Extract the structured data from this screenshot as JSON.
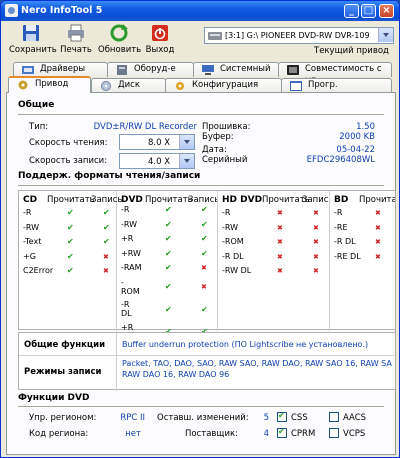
{
  "window": {
    "title": "Nero InfoTool 5",
    "minimize_glyph": "_",
    "maximize_glyph": "□",
    "close_glyph": "×"
  },
  "toolbar": {
    "save_label": "Сохранить",
    "print_label": "Печать",
    "refresh_label": "Обновить",
    "exit_label": "Выход",
    "drive_select_value": "[3:1] G:\\ PIONEER  DVD-RW  DVR-109",
    "current_drive_label": "Текущий привод"
  },
  "tabs_row1": [
    "Драйверы",
    "Оборуд-е",
    "Системный",
    "Совместимость с HD"
  ],
  "tabs_row2": [
    "Привод",
    "Диск",
    "Конфигурация",
    "Прогр. обеспечение"
  ],
  "general": {
    "section_title": "Общие",
    "type_label": "Тип:",
    "type_value": "DVD±R/RW DL Recorder",
    "read_speed_label": "Скорость чтения:",
    "read_speed_value": "8.0 X",
    "write_speed_label": "Скорость записи:",
    "write_speed_value": "4.0 X",
    "firmware_label": "Прошивка:",
    "firmware_value": "1.50",
    "buffer_label": "Буфер:",
    "buffer_value": "2000 KB",
    "date_label": "Дата:",
    "date_value": "05-04-22",
    "serial_label": "Серийный",
    "serial_value": "EFDC296408WL"
  },
  "formats": {
    "section_title": "Поддерж. форматы чтения/записи",
    "read_header": "Прочитать",
    "write_header": "Запись",
    "columns": [
      {
        "title": "CD",
        "rows": [
          {
            "name": "-R",
            "read": true,
            "write": true
          },
          {
            "name": "-RW",
            "read": true,
            "write": true
          },
          {
            "name": "-Text",
            "read": true,
            "write": true
          },
          {
            "name": "+G",
            "read": true,
            "write": false
          },
          {
            "name": "C2Error",
            "read": true,
            "write": false
          }
        ]
      },
      {
        "title": "DVD",
        "rows": [
          {
            "name": "-R",
            "read": true,
            "write": true
          },
          {
            "name": "-RW",
            "read": true,
            "write": true
          },
          {
            "name": "+R",
            "read": true,
            "write": true
          },
          {
            "name": "+RW",
            "read": true,
            "write": true
          },
          {
            "name": "-RAM",
            "read": true,
            "write": false
          },
          {
            "name": "-\nROM",
            "read": true,
            "write": false
          },
          {
            "name": "-R\nDL",
            "read": true,
            "write": true
          },
          {
            "name": "+R\nDL",
            "read": true,
            "write": true
          }
        ]
      },
      {
        "title": "HD DVD",
        "rows": [
          {
            "name": "-R",
            "read": false,
            "write": false
          },
          {
            "name": "-RW",
            "read": false,
            "write": false
          },
          {
            "name": "-ROM",
            "read": false,
            "write": false
          },
          {
            "name": "-R DL",
            "read": false,
            "write": false
          },
          {
            "name": "-RW DL",
            "read": false,
            "write": false
          }
        ]
      },
      {
        "title": "BD",
        "rows": [
          {
            "name": "-R",
            "read": false
          },
          {
            "name": "-RE",
            "read": false
          },
          {
            "name": "-R DL",
            "read": false
          },
          {
            "name": "-RE DL",
            "read": false
          }
        ]
      }
    ],
    "bd_read_header": "Прочита"
  },
  "features": {
    "general_label": "Общие функции",
    "general_value": "Buffer underrun protection (ПО Lightscribe не установлено.)",
    "write_modes_label": "Режимы записи",
    "write_modes_value_line1": "Packet, TAO, DAO, SAO, RAW SAO, RAW DAO, RAW SAO 16, RAW SA",
    "write_modes_value_line2": "RAW DAO 16, RAW DAO 96"
  },
  "dvd_functions": {
    "section_title": "Функции DVD",
    "region_ctrl_label": "Упр. регионом:",
    "region_ctrl_value": "RPC II",
    "changes_left_label": "Оставш. изменений:",
    "changes_left_value": "5",
    "region_code_label": "Код региона:",
    "region_code_value": "нет",
    "vendor_label": "Поставщик:",
    "vendor_value": "4",
    "css_label": "CSS",
    "cprm_label": "CPRM",
    "aacs_label": "AACS",
    "vcps_label": "VCPS",
    "css_checked": true,
    "cprm_checked": true,
    "aacs_checked": false,
    "vcps_checked": false
  }
}
